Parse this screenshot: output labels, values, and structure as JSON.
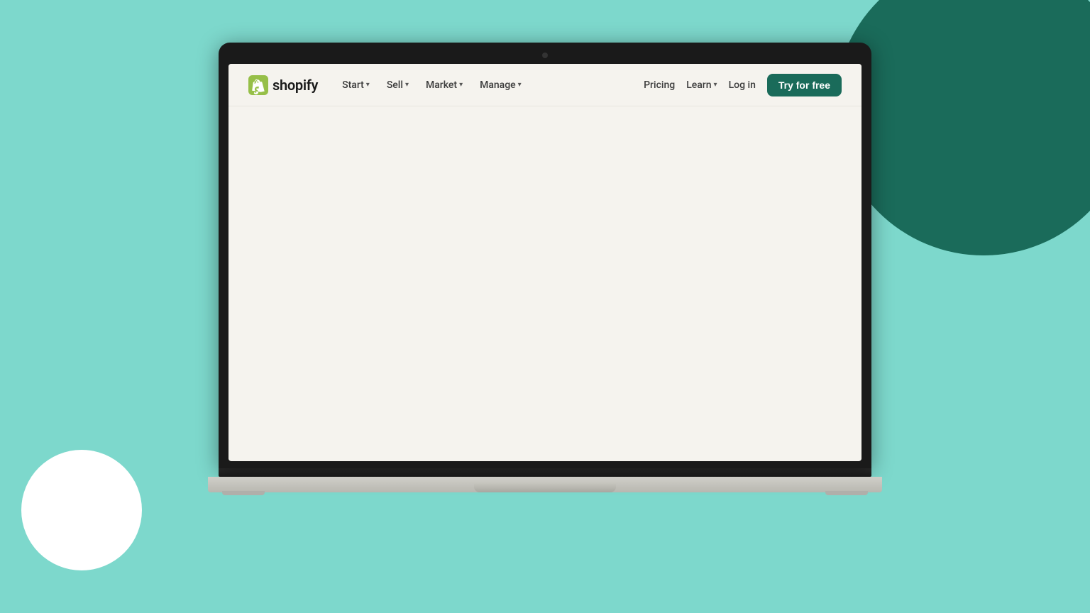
{
  "background": {
    "color": "#7dd8cc"
  },
  "decorations": {
    "circle_top_right_color": "#1a6b5a",
    "circle_bottom_left_color": "#ffffff"
  },
  "navbar": {
    "logo_text": "shopify",
    "nav_left": [
      {
        "label": "Start",
        "has_dropdown": true
      },
      {
        "label": "Sell",
        "has_dropdown": true
      },
      {
        "label": "Market",
        "has_dropdown": true
      },
      {
        "label": "Manage",
        "has_dropdown": true
      }
    ],
    "nav_right": [
      {
        "label": "Pricing",
        "has_dropdown": false
      },
      {
        "label": "Learn",
        "has_dropdown": true
      },
      {
        "label": "Log in",
        "has_dropdown": false
      }
    ],
    "cta_button": "Try for free",
    "cta_color": "#1a6b5a"
  }
}
